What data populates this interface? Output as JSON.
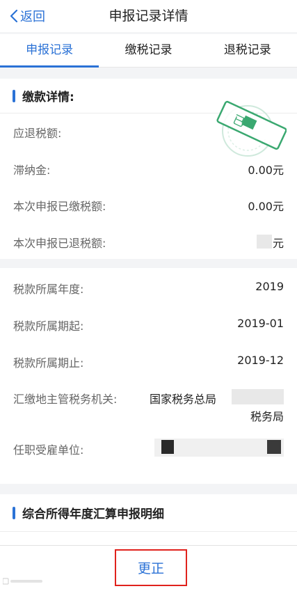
{
  "nav": {
    "back_label": "返回",
    "title": "申报记录详情"
  },
  "tabs": [
    {
      "label": "申报记录",
      "active": true
    },
    {
      "label": "缴税记录",
      "active": false
    },
    {
      "label": "退税记录",
      "active": false
    }
  ],
  "payment": {
    "section_title": "缴款详情:",
    "rows": [
      {
        "label": "应退税额:",
        "value": ""
      },
      {
        "label": "滞纳金:",
        "value": "0.00元"
      },
      {
        "label": "本次申报已缴税额:",
        "value": "0.00元"
      },
      {
        "label": "本次申报已退税额:",
        "value": "元"
      }
    ],
    "stamp_text": "已"
  },
  "tax_info": {
    "rows": [
      {
        "label": "税款所属年度:",
        "value": "2019"
      },
      {
        "label": "税款所属期起:",
        "value": "2019-01"
      },
      {
        "label": "税款所属期止:",
        "value": "2019-12"
      },
      {
        "label": "汇缴地主管税务机关:",
        "value_line1": "国家税务总局",
        "value_line2": "税务局"
      },
      {
        "label": "任职受雇单位:",
        "value": ""
      }
    ]
  },
  "annual": {
    "section_title": "综合所得年度汇算申报明细"
  },
  "footer": {
    "button_label": "更正"
  },
  "colors": {
    "accent": "#2b72d6",
    "stamp_green": "#3aa870",
    "highlight_red": "#e0221c"
  }
}
